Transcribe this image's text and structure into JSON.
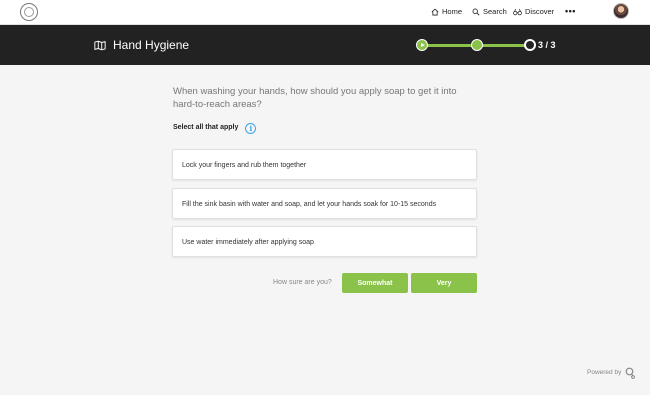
{
  "nav": {
    "home_label": "Home",
    "search_label": "Search",
    "discover_label": "Discover",
    "more_icon": "more-horizontal-icon",
    "logo_icon": "seal-logo",
    "avatar": "user-avatar"
  },
  "lesson": {
    "title": "Hand Hygiene",
    "title_icon": "map-icon",
    "progress": {
      "current": 3,
      "total": 3,
      "label": "3 / 3"
    }
  },
  "question": {
    "text": "When washing your hands, how should you apply soap to get it into hard-to-reach areas?",
    "hint": "Select all that apply",
    "hint_icon": "info-icon",
    "options": [
      "Lock your fingers and rub them together",
      "Fill the sink basin with water and soap, and let your hands soak for 10-15 seconds",
      "Use water immediately after applying soap"
    ]
  },
  "confidence": {
    "prompt": "How sure are you?",
    "somewhat_label": "Somewhat",
    "very_label": "Very"
  },
  "footer": {
    "powered_by": "Powered by"
  },
  "colors": {
    "accent_green": "#8bc34a",
    "header_bg": "#222222",
    "info_blue": "#3aa5e8",
    "page_bg": "#f5f5f5"
  }
}
